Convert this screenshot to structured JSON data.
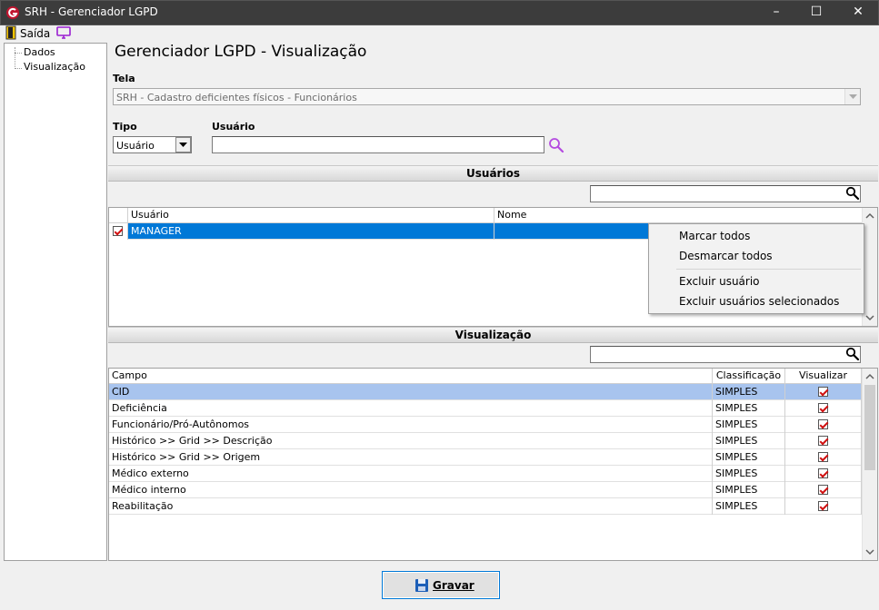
{
  "window": {
    "title": "SRH - Gerenciador LGPD",
    "minimize": "–",
    "maximize": "☐",
    "close": "✕"
  },
  "toolbar": {
    "exit_label": "Saída"
  },
  "tree": {
    "items": [
      "Dados",
      "Visualização"
    ]
  },
  "page": {
    "title": "Gerenciador LGPD - Visualização"
  },
  "form": {
    "tela_label": "Tela",
    "tela_value": "SRH - Cadastro deficientes físicos - Funcionários",
    "tipo_label": "Tipo",
    "tipo_value": "Usuário",
    "usuario_label": "Usuário",
    "usuario_value": ""
  },
  "usuarios": {
    "header": "Usuários",
    "search_value": "",
    "columns": [
      "Usuário",
      "Nome"
    ],
    "rows": [
      {
        "usuario": "MANAGER",
        "nome": "",
        "checked": true
      }
    ]
  },
  "context_menu": {
    "items": [
      "Marcar todos",
      "Desmarcar todos",
      "Excluir usuário",
      "Excluir usuários selecionados"
    ]
  },
  "visualizacao": {
    "header": "Visualização",
    "search_value": "",
    "columns": [
      "Campo",
      "Classificação",
      "Visualizar"
    ],
    "rows": [
      {
        "campo": "CID",
        "classificacao": "SIMPLES",
        "visualizar": true
      },
      {
        "campo": "Deficiência",
        "classificacao": "SIMPLES",
        "visualizar": true
      },
      {
        "campo": "Funcionário/Pró-Autônomos",
        "classificacao": "SIMPLES",
        "visualizar": true
      },
      {
        "campo": "Histórico >> Grid >> Descrição",
        "classificacao": "SIMPLES",
        "visualizar": true
      },
      {
        "campo": "Histórico >> Grid >> Origem",
        "classificacao": "SIMPLES",
        "visualizar": true
      },
      {
        "campo": "Médico externo",
        "classificacao": "SIMPLES",
        "visualizar": true
      },
      {
        "campo": "Médico interno",
        "classificacao": "SIMPLES",
        "visualizar": true
      },
      {
        "campo": "Reabilitação",
        "classificacao": "SIMPLES",
        "visualizar": true
      }
    ]
  },
  "actions": {
    "save_label": "Gravar"
  },
  "colors": {
    "titlebar": "#3c3c3c",
    "selection": "#0078d7",
    "selected_row": "#a8c4ee"
  }
}
